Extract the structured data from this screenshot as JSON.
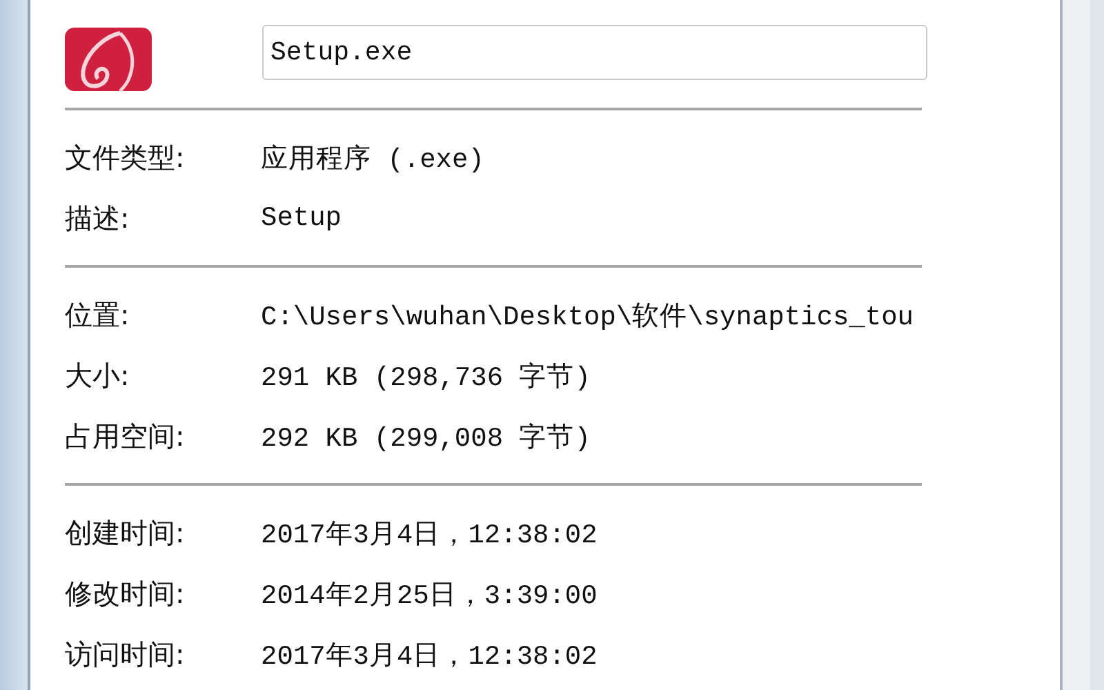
{
  "file_name": "Setup.exe",
  "sections": [
    {
      "rows": [
        {
          "label": "文件类型:",
          "value": "应用程序 (.exe)"
        },
        {
          "label": "描述:",
          "value": "Setup"
        }
      ]
    },
    {
      "rows": [
        {
          "label": "位置:",
          "value": "C:\\Users\\wuhan\\Desktop\\软件\\synaptics_tou"
        },
        {
          "label": "大小:",
          "value": "291 KB (298,736 字节)"
        },
        {
          "label": "占用空间:",
          "value": "292 KB (299,008 字节)"
        }
      ]
    },
    {
      "rows": [
        {
          "label": "创建时间:",
          "value": "2017年3月4日，12:38:02"
        },
        {
          "label": "修改时间:",
          "value": "2014年2月25日，3:39:00"
        },
        {
          "label": "访问时间:",
          "value": "2017年3月4日，12:38:02"
        }
      ]
    }
  ]
}
